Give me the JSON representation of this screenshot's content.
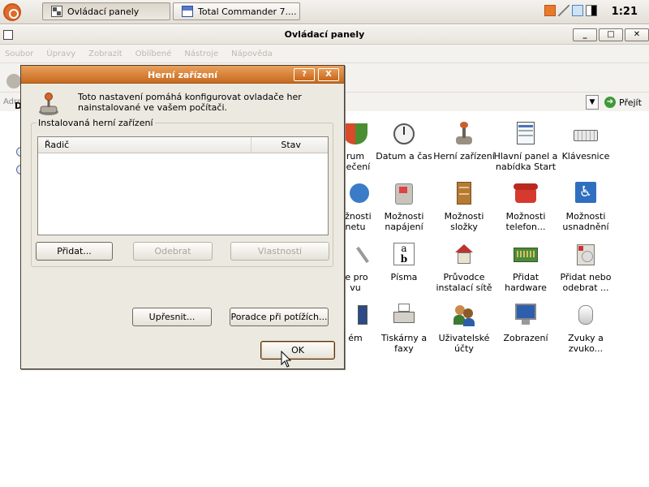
{
  "taskbar": {
    "tasks": [
      {
        "label": "Ovládací panely",
        "icon": "control-panel-icon"
      },
      {
        "label": "Total Commander 7....",
        "icon": "total-commander-icon"
      }
    ],
    "clock": "1:21"
  },
  "main_window": {
    "title": "Ovládací panely",
    "menu": [
      "Soubor",
      "Úpravy",
      "Zobrazit",
      "Oblíbené",
      "Nástroje",
      "Nápověda"
    ],
    "address_label": "Adre",
    "go_label": "Přejít",
    "sidebar_fragment": "D",
    "icons": [
      {
        "label1": "rum",
        "label2": "pečení",
        "icon": "security-center-icon"
      },
      {
        "label1": "Datum a čas",
        "label2": "",
        "icon": "clock-icon"
      },
      {
        "label1": "Herní zařízení",
        "label2": "",
        "icon": "joystick-icon"
      },
      {
        "label1": "Hlavní panel a",
        "label2": "nabídka Start",
        "icon": "taskbar-icon"
      },
      {
        "label1": "Klávesnice",
        "label2": "",
        "icon": "keyboard-icon"
      },
      {
        "label1": "ožnosti",
        "label2": "netu",
        "icon": "internet-options-icon"
      },
      {
        "label1": "Možnosti",
        "label2": "napájení",
        "icon": "power-options-icon"
      },
      {
        "label1": "Možnosti",
        "label2": "složky",
        "icon": "folder-options-icon"
      },
      {
        "label1": "Možnosti",
        "label2": "telefon...",
        "icon": "phone-icon"
      },
      {
        "label1": "Možnosti",
        "label2": "usnadnění",
        "icon": "accessibility-icon"
      },
      {
        "label1": "je pro",
        "label2": "vu",
        "icon": "tools-icon"
      },
      {
        "label1": "Písma",
        "label2": "",
        "icon": "fonts-icon"
      },
      {
        "label1": "Průvodce",
        "label2": "instalací sítě",
        "icon": "network-setup-icon"
      },
      {
        "label1": "Přidat",
        "label2": "hardware",
        "icon": "hardware-icon"
      },
      {
        "label1": "Přidat nebo",
        "label2": "odebrat ...",
        "icon": "add-remove-icon"
      },
      {
        "label1": "ém",
        "label2": "",
        "icon": "system-icon"
      },
      {
        "label1": "Tiskárny a",
        "label2": "faxy",
        "icon": "printer-icon"
      },
      {
        "label1": "Uživatelské",
        "label2": "účty",
        "icon": "user-accounts-icon"
      },
      {
        "label1": "Zobrazení",
        "label2": "",
        "icon": "display-icon"
      },
      {
        "label1": "Zvuky a",
        "label2": "zvuko...",
        "icon": "sound-icon"
      }
    ]
  },
  "dialog": {
    "title": "Herní zařízení",
    "help_label": "?",
    "close_label": "X",
    "description": "Toto nastavení pomáhá konfigurovat ovladače her nainstalované ve vašem počítači.",
    "group_label": "Instalovaná herní zařízení",
    "columns": [
      "Řadič",
      "Stav"
    ],
    "buttons": {
      "add": "Přidat...",
      "remove": "Odebrat",
      "properties": "Vlastnosti",
      "advanced": "Upřesnit...",
      "troubleshoot": "Poradce při potížích...",
      "ok": "OK"
    }
  },
  "colors": {
    "dialog_title": "#c86a1f",
    "dialog_bg": "#ece9e0",
    "accent": "#e06b2b"
  }
}
